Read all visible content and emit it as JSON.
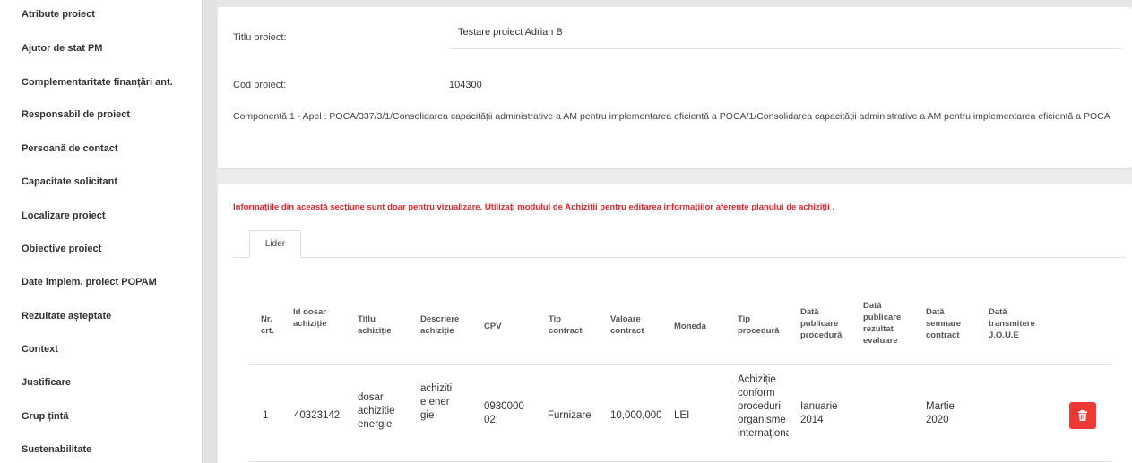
{
  "sidebar": {
    "items": [
      {
        "label": "Atribute proiect"
      },
      {
        "label": "Ajutor de stat PM"
      },
      {
        "label": "Complementaritate finanțări ant."
      },
      {
        "label": "Responsabil de proiect"
      },
      {
        "label": "Persoană de contact"
      },
      {
        "label": "Capacitate solicitant"
      },
      {
        "label": "Localizare proiect"
      },
      {
        "label": "Obiective proiect"
      },
      {
        "label": "Date implem. proiect POPAM"
      },
      {
        "label": "Rezultate așteptate"
      },
      {
        "label": "Context"
      },
      {
        "label": "Justificare"
      },
      {
        "label": "Grup țintă"
      },
      {
        "label": "Sustenabilitate"
      }
    ]
  },
  "project": {
    "title_label": "Titlu proiect:",
    "title_value": "Testare proiect Adrian B",
    "code_label": "Cod proiect:",
    "code_value": "104300",
    "component_text": "Componentă 1 - Apel : POCA/337/3/1/Consolidarea capacității administrative a AM pentru implementarea eficientă a POCA/1/Consolidarea capacității administrative a AM pentru implementarea eficientă a POCA"
  },
  "acquisitions": {
    "warning": "Informațiile din această secțiune sunt doar pentru vizualizare. Utilizați modulul de Achiziții pentru editarea informațiilor aferente planului de achiziții .",
    "tabs": [
      {
        "label": "Lider"
      }
    ],
    "columns": {
      "nr": "Nr. crt.",
      "id_dosar": "Id dosar achiziție",
      "titlu": "Titlu achiziție",
      "descriere": "Descriere achiziție",
      "cpv": "CPV",
      "tip_contract": "Tip contract",
      "valoare": "Valoare contract",
      "moneda": "Moneda",
      "tip_procedura": "Tip procedură",
      "data_publicare": "Dată publicare procedură",
      "data_rezultat": "Dată publicare rezultat evaluare",
      "data_semnare": "Dată semnare contract",
      "data_joue": "Dată transmitere J.O.U.E"
    },
    "rows": [
      {
        "nr": "1",
        "id_dosar": "40323142",
        "titlu": "dosar achizitie energie",
        "descriere": "achizitie energie",
        "cpv": "093000002;",
        "tip_contract": "Furnizare",
        "valoare": "10,000,000",
        "moneda": "LEI",
        "tip_procedura": "Achiziție conform proceduri organisme internațional",
        "data_publicare": "Ianuarie 2014",
        "data_rezultat": "",
        "data_semnare": "Martie 2020",
        "data_joue": ""
      }
    ],
    "delete_icon": "trash-icon",
    "accent_color": "#ec3a36"
  }
}
